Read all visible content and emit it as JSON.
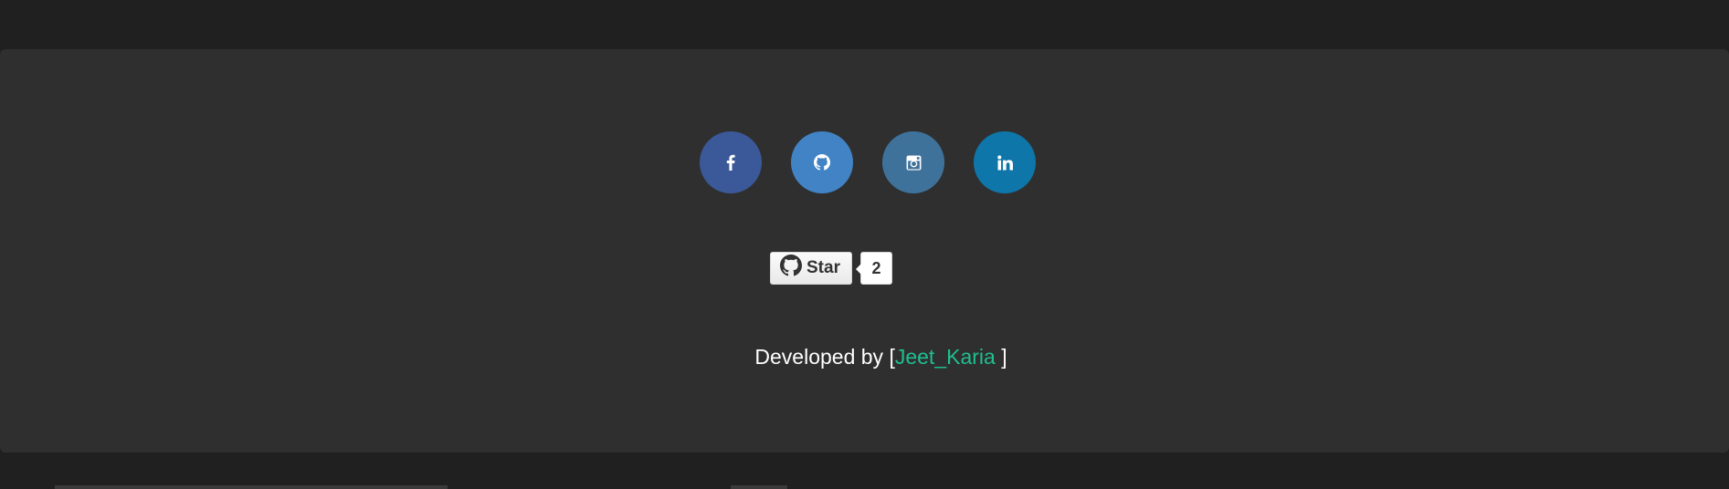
{
  "social": {
    "links": [
      {
        "name": "facebook",
        "icon": "facebook-icon",
        "color": "#3b5998"
      },
      {
        "name": "github",
        "icon": "github-icon",
        "color": "#4183c4"
      },
      {
        "name": "instagram",
        "icon": "instagram-icon",
        "color": "#3f729b"
      },
      {
        "name": "linkedin",
        "icon": "linkedin-icon",
        "color": "#0e76a8"
      }
    ]
  },
  "github_star": {
    "label": "Star",
    "count": "2",
    "icon": "github-icon"
  },
  "credit": {
    "prefix": "Developed by",
    "open_bracket": "[",
    "author": "Jeet_Karia",
    "close_bracket": "]",
    "author_color": "#1fbf8f"
  },
  "colors": {
    "page_background": "#202020",
    "panel_background": "#2f2f2f"
  }
}
